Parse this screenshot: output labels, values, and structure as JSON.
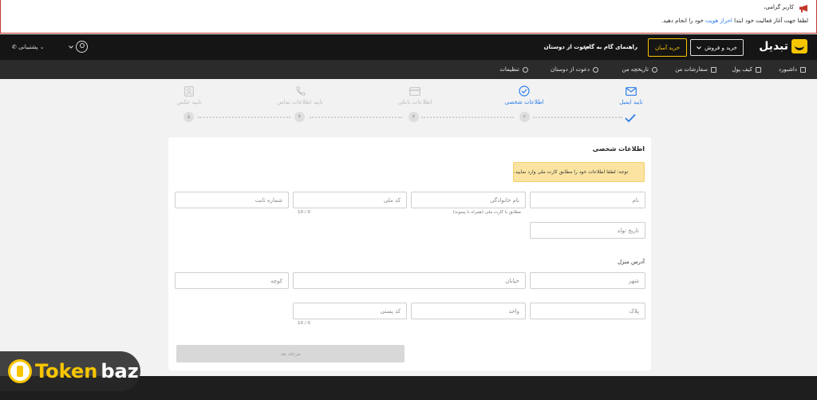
{
  "announcement": {
    "title": "کاربر گرامی،",
    "message_before": "لطفا جهت آغاز فعالیت خود ابتدا ",
    "message_link": "احراز هویت",
    "message_after": " خود را انجام دهید."
  },
  "header": {
    "brand": "تبدیل",
    "trade_button": "خرید و فروش",
    "easy_buy_button": "خرید آسان",
    "nav": [
      "راهنمای گام به گام",
      "دعوت از دوستان"
    ],
    "support": "پشتیبانی"
  },
  "subnav": {
    "items": [
      "داشبورد",
      "کیف پول",
      "سفارشات من",
      "تاریخچه من",
      "دعوت از دوستان",
      "تنظیمات"
    ]
  },
  "steps": [
    {
      "label": "تایید ایمیل",
      "state": "done"
    },
    {
      "label": "اطلاعات شخصی",
      "state": "current",
      "number": "۲"
    },
    {
      "label": "اطلاعات بانکی",
      "state": "pending",
      "number": "۳"
    },
    {
      "label": "تایید اطلاعات تماس",
      "state": "pending",
      "number": "۴"
    },
    {
      "label": "تایید عکس",
      "state": "pending",
      "number": "۵"
    }
  ],
  "colors": {
    "accent": "#2b7de9",
    "brand_yellow": "#f7c600",
    "header_bg": "#151515",
    "notice_bg": "#fbe4a1"
  },
  "form": {
    "title": "اطلاعات شخصی",
    "notice": "توجه: لطفا اطلاعات خود را مطابق کارت ملی وارد نمایید.",
    "first_name": "نام",
    "last_name": "نام خانوادگی",
    "last_name_hint": "مطابق با کارت ملی (همراه با پسوند)",
    "national_code": "کد ملی",
    "national_code_counter": "10 / 0",
    "landline": "شماره ثابت",
    "birth_date": "تاریخ تولد",
    "address_label": "آدرس منزل",
    "city": "شهر",
    "street": "خیابان",
    "alley": "کوچه",
    "plaque": "پلاک",
    "unit": "واحد",
    "postal_code": "کد پستی",
    "postal_code_counter": "10 / 0",
    "next_button": "مرحله بعد"
  },
  "watermark": {
    "part1": "Token",
    "part2": "baz"
  }
}
